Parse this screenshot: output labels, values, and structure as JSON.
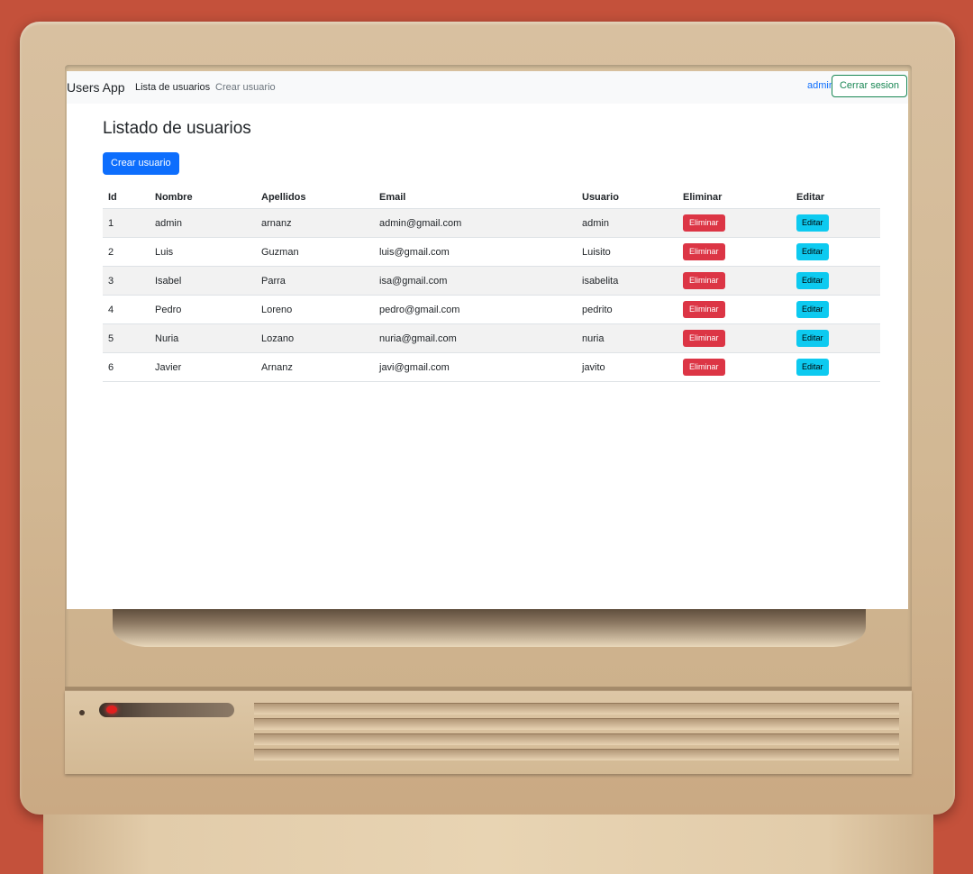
{
  "navbar": {
    "brand": "Users App",
    "links": [
      "Lista de usuarios",
      "Crear usuario"
    ],
    "current_user": "admin",
    "logout_label": "Cerrar sesion"
  },
  "page": {
    "title": "Listado de usuarios",
    "create_button": "Crear usuario"
  },
  "table": {
    "headers": [
      "Id",
      "Nombre",
      "Apellidos",
      "Email",
      "Usuario",
      "Eliminar",
      "Editar"
    ],
    "delete_label": "Eliminar",
    "edit_label": "Editar",
    "rows": [
      {
        "id": "1",
        "nombre": "admin",
        "apellidos": "arnanz",
        "email": "admin@gmail.com",
        "usuario": "admin"
      },
      {
        "id": "2",
        "nombre": "Luis",
        "apellidos": "Guzman",
        "email": "luis@gmail.com",
        "usuario": "Luisito"
      },
      {
        "id": "3",
        "nombre": "Isabel",
        "apellidos": "Parra",
        "email": "isa@gmail.com",
        "usuario": "isabelita"
      },
      {
        "id": "4",
        "nombre": "Pedro",
        "apellidos": "Loreno",
        "email": "pedro@gmail.com",
        "usuario": "pedrito"
      },
      {
        "id": "5",
        "nombre": "Nuria",
        "apellidos": "Lozano",
        "email": "nuria@gmail.com",
        "usuario": "nuria"
      },
      {
        "id": "6",
        "nombre": "Javier",
        "apellidos": "Arnanz",
        "email": "javi@gmail.com",
        "usuario": "javito"
      }
    ]
  },
  "colors": {
    "primary": "#0d6efd",
    "danger": "#dc3545",
    "info": "#0dcaf0",
    "success": "#198754",
    "backdrop": "#c4513b",
    "monitor": "#d2b894"
  }
}
